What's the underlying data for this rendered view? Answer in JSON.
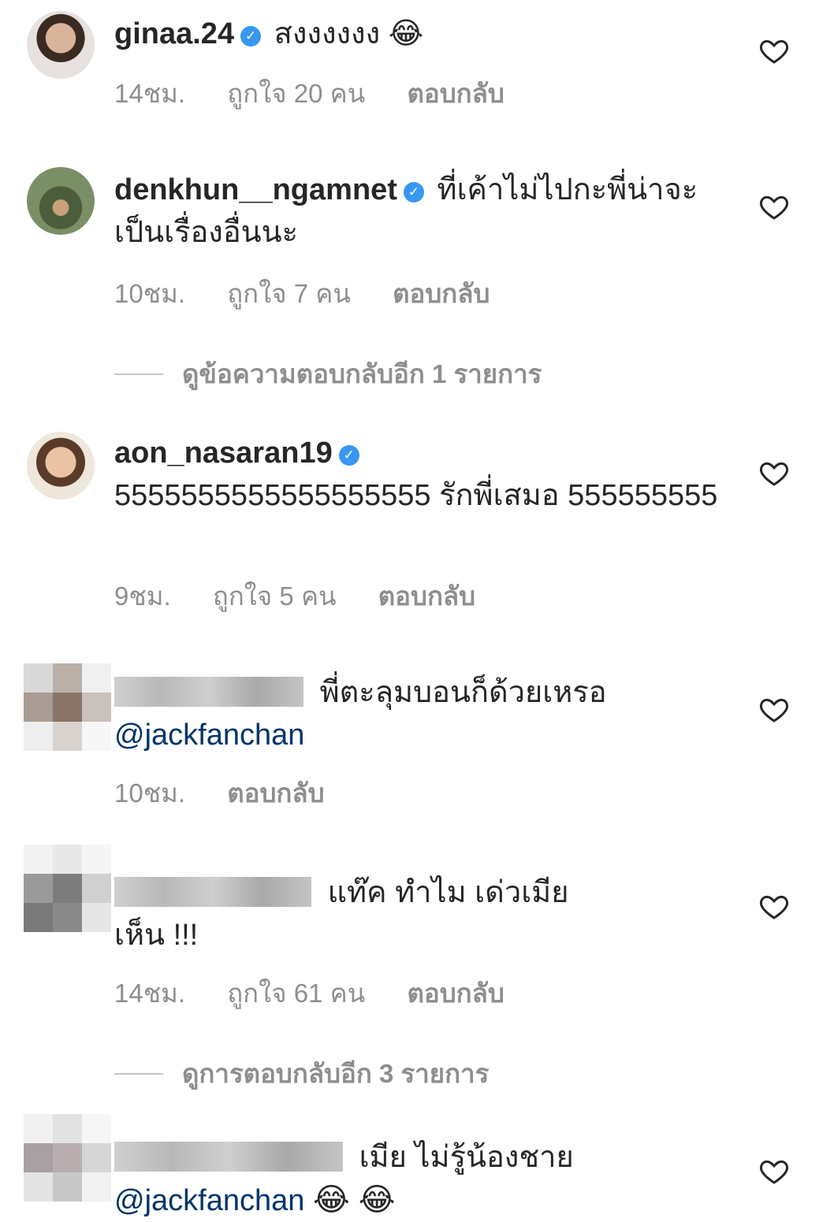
{
  "comments": [
    {
      "username": "ginaa.24",
      "verified": true,
      "text": "สงงงงงง 😂",
      "time": "14ชม.",
      "likes": "ถูกใจ 20 คน",
      "reply": "ตอบกลับ"
    },
    {
      "username": "denkhun__ngamnet",
      "verified": true,
      "text": "ที่เค้าไม่ไปกะพี่น่าจะเป็นเรื่องอื่นนะ",
      "time": "10ชม.",
      "likes": "ถูกใจ 7 คน",
      "reply": "ตอบกลับ",
      "view_more": "ดูข้อความตอบกลับอีก 1 รายการ"
    },
    {
      "username": "aon_nasaran19",
      "verified": true,
      "text": "5555555555555555555 รักพี่เสมอ 555555555",
      "time": "9ชม.",
      "likes": "ถูกใจ 5 คน",
      "reply": "ตอบกลับ"
    },
    {
      "text": "พี่ตะลุมบอนก็ด้วยเหรอ",
      "mention": "@jackfanchan",
      "time": "10ชม.",
      "reply": "ตอบกลับ"
    },
    {
      "text": "แท๊ค ทำไม เด่วเมีย",
      "text2": "เห็น !!!",
      "time": "14ชม.",
      "likes": "ถูกใจ 61 คน",
      "reply": "ตอบกลับ",
      "view_more": "ดูการตอบกลับอีก 3 รายการ"
    },
    {
      "text": "เมีย ไม่รู้น้องชาย",
      "mention": "@jackfanchan",
      "emoji": "😂 😂"
    }
  ],
  "icons": {
    "like": "heart-outline-icon",
    "verified": "verified-badge-icon"
  },
  "colors": {
    "verified": "#3897f0",
    "meta": "#8e8e8e",
    "mention": "#003569"
  }
}
